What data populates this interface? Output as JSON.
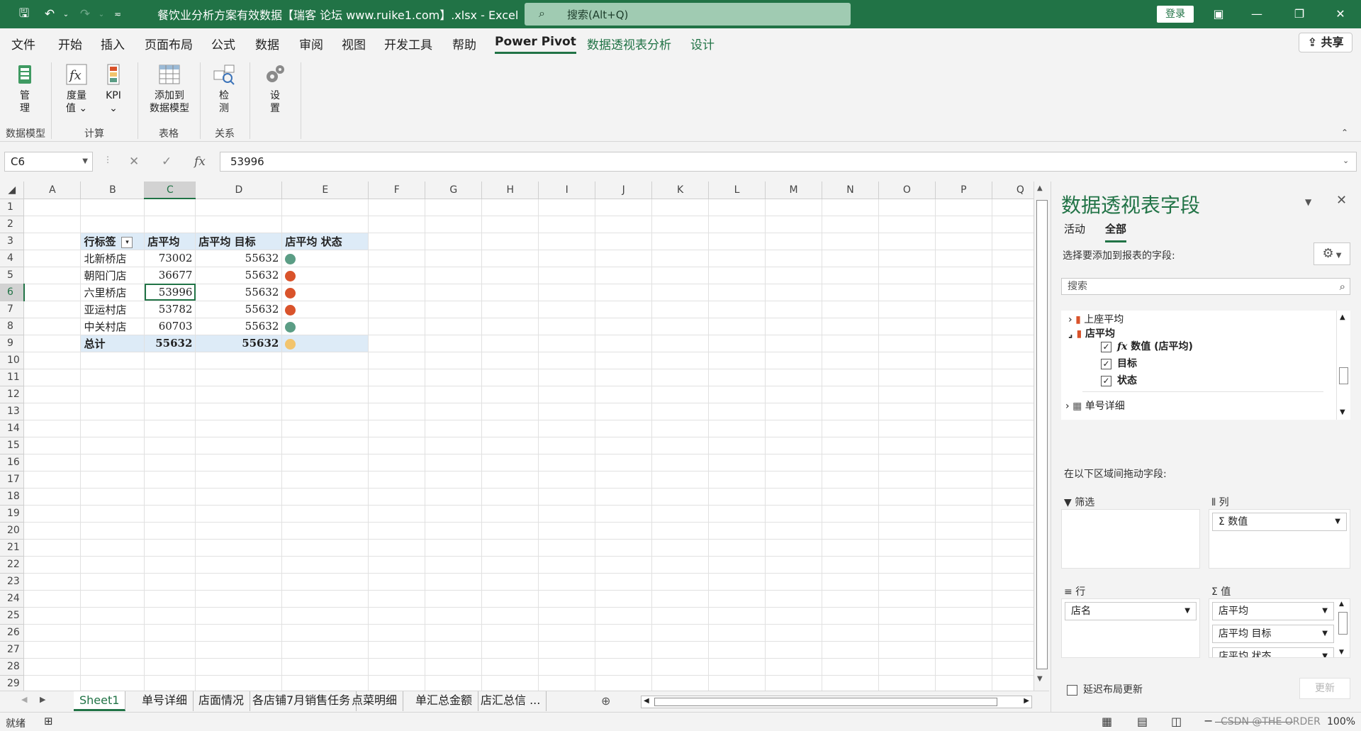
{
  "title_bar": {
    "doc_title": "餐饮业分析方案有效数据【瑞客 论坛 www.ruike1.com】.xlsx  -  Excel",
    "search_placeholder": "搜索(Alt+Q)",
    "login_label": "登录"
  },
  "menu": {
    "tabs": [
      "文件",
      "开始",
      "插入",
      "页面布局",
      "公式",
      "数据",
      "审阅",
      "视图",
      "开发工具",
      "帮助",
      "Power Pivot",
      "数据透视表分析",
      "设计"
    ],
    "active_tab": "Power Pivot",
    "share_label": "共享"
  },
  "ribbon": {
    "buttons": [
      {
        "label": "管\n理",
        "icon": "excel-cube-icon"
      },
      {
        "label": "度量\n值 ⌄",
        "icon": "function-icon"
      },
      {
        "label": "KPI\n⌄",
        "icon": "kpi-icon"
      },
      {
        "label": "添加到\n数据模型",
        "icon": "table-grid-icon"
      },
      {
        "label": "检\n测",
        "icon": "detect-icon"
      },
      {
        "label": "设\n置",
        "icon": "gears-icon"
      }
    ],
    "groups": [
      "数据模型",
      "计算",
      "表格",
      "关系"
    ]
  },
  "formula_bar": {
    "name_box": "C6",
    "formula": "53996"
  },
  "grid": {
    "columns": [
      "A",
      "B",
      "C",
      "D",
      "E",
      "F",
      "G",
      "H",
      "I",
      "J",
      "K",
      "L",
      "M",
      "N",
      "O",
      "P",
      "Q"
    ],
    "selected_column": "C",
    "selected_row": 6,
    "row_count": 29,
    "pivot": {
      "header": [
        "行标签",
        "店平均",
        "店平均 目标",
        "店平均 状态"
      ],
      "rows": [
        {
          "name": "北新桥店",
          "avg": "73002",
          "target": "55632",
          "status": "green"
        },
        {
          "name": "朝阳门店",
          "avg": "36677",
          "target": "55632",
          "status": "red"
        },
        {
          "name": "六里桥店",
          "avg": "53996",
          "target": "55632",
          "status": "red"
        },
        {
          "name": "亚运村店",
          "avg": "53782",
          "target": "55632",
          "status": "red"
        },
        {
          "name": "中关村店",
          "avg": "60703",
          "target": "55632",
          "status": "green"
        }
      ],
      "total": {
        "name": "总计",
        "avg": "55632",
        "target": "55632",
        "status": "yellow"
      }
    }
  },
  "status_colors": {
    "green": "#5b9d85",
    "red": "#d9532b",
    "yellow": "#f2c46d"
  },
  "sheet_tabs": [
    "Sheet1",
    "单号详细",
    "店面情况",
    "各店铺7月销售任务",
    "点菜明细",
    "单汇总金额",
    "店汇总信 ..."
  ],
  "active_sheet": "Sheet1",
  "status_bar": {
    "ready": "就绪",
    "zoom": "100%",
    "watermark": "CSDN @THE ORDER"
  },
  "pivot_pane": {
    "title": "数据透视表字段",
    "tabs": [
      "活动",
      "全部"
    ],
    "active_tab": "全部",
    "prompt": "选择要添加到报表的字段:",
    "search_placeholder": "搜索",
    "fields": [
      {
        "label": "上座平均",
        "kind": "kpi"
      },
      {
        "label": "店平均",
        "kind": "kpi"
      },
      {
        "label": "数值 (店平均)",
        "kind": "value"
      },
      {
        "label": "目标",
        "kind": "check"
      },
      {
        "label": "状态",
        "kind": "check"
      },
      {
        "label": "单号详细",
        "kind": "table"
      }
    ],
    "drag_label": "在以下区域间拖动字段:",
    "areas": {
      "filter": {
        "label": "筛选",
        "items": []
      },
      "columns": {
        "label": "列",
        "items": [
          "Σ 数值"
        ]
      },
      "rows": {
        "label": "行",
        "items": [
          "店名"
        ]
      },
      "values": {
        "label": "值",
        "items": [
          "店平均",
          "店平均 目标",
          "店平均 状态"
        ]
      }
    },
    "defer_label": "延迟布局更新",
    "update_label": "更新"
  }
}
